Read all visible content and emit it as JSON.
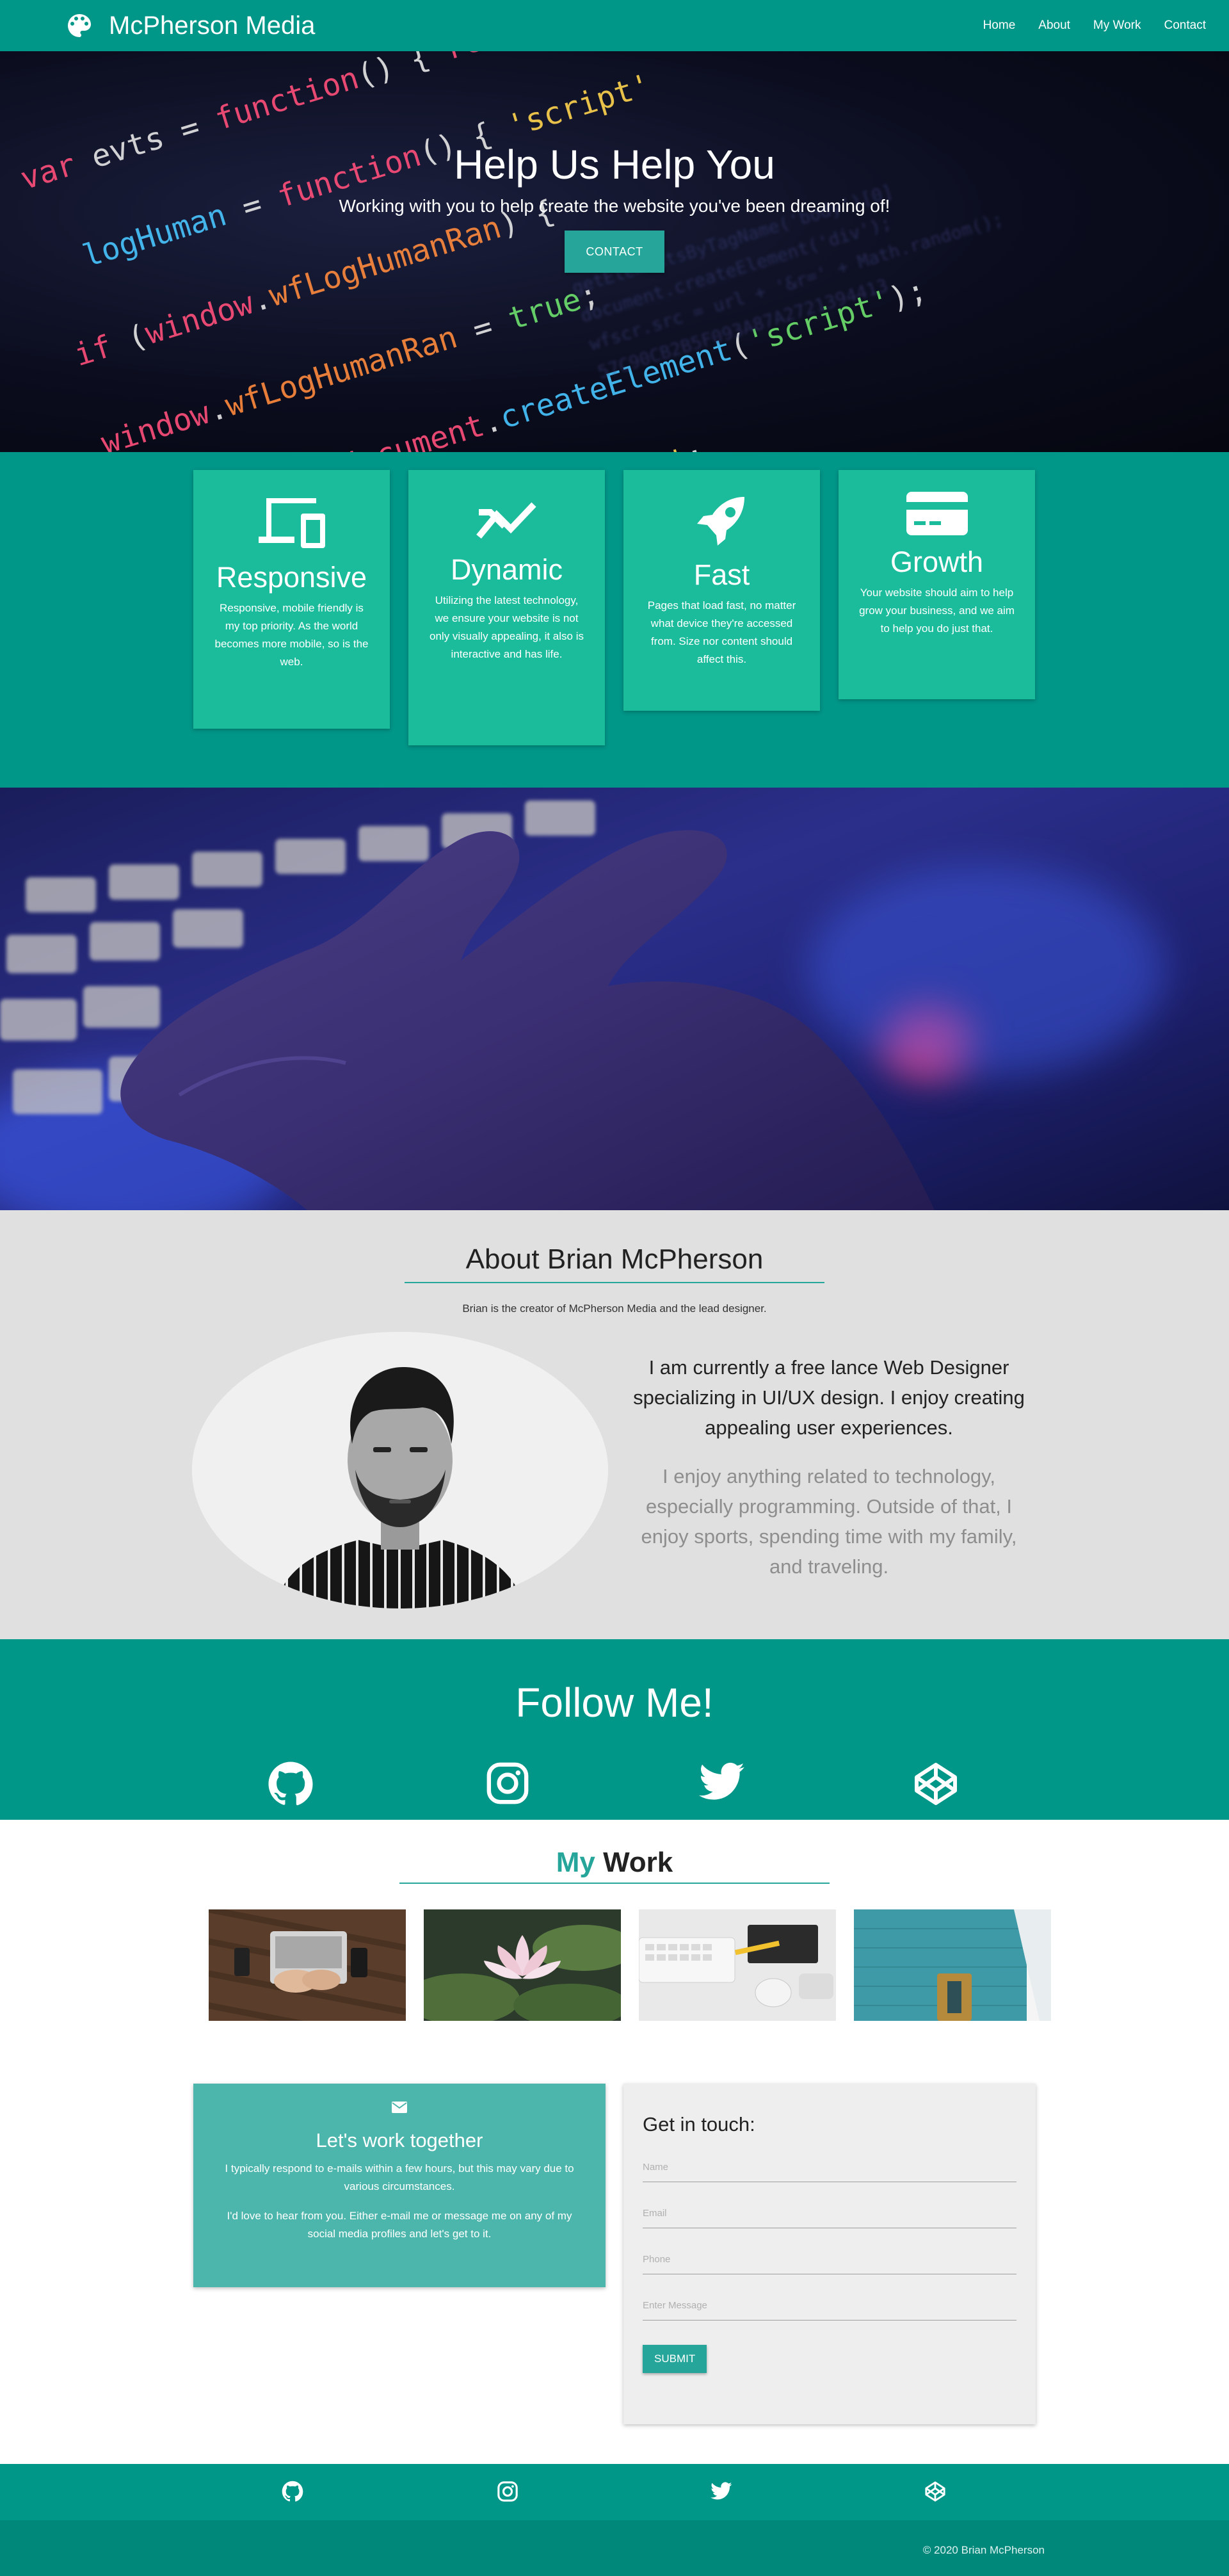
{
  "nav": {
    "brand": "McPherson Media",
    "links": [
      "Home",
      "About",
      "My Work",
      "Contact"
    ]
  },
  "hero": {
    "title": "Help Us Help You",
    "subtitle": "Working with you to help create the website you've been dreaming of!",
    "button": "CONTACT"
  },
  "features": [
    {
      "icon": "devices-icon",
      "title": "Responsive",
      "text": "Responsive, mobile friendly is my top priority. As the world becomes more mobile, so is the web."
    },
    {
      "icon": "trending-icon",
      "title": "Dynamic",
      "text": "Utilizing the latest technology, we ensure your website is not only visually appealing, it also is interactive and has life."
    },
    {
      "icon": "rocket-icon",
      "title": "Fast",
      "text": "Pages that load fast, no matter what device they're accessed from. Size nor content should affect this."
    },
    {
      "icon": "credit-card-icon",
      "title": "Growth",
      "text": "Your website should aim to help grow your business, and we aim to help you do just that."
    }
  ],
  "about": {
    "title": "About Brian McPherson",
    "intro": "Brian is the creator of McPherson Media and the lead designer.",
    "p1": "I am currently a free lance Web Designer specializing in UI/UX design. I enjoy creating appealing user experiences.",
    "p2": "I enjoy anything related to technology, especially programming. Outside of that, I enjoy sports, spending time with my family, and traveling."
  },
  "follow": {
    "title": "Follow Me!",
    "icons": [
      "github-icon",
      "instagram-icon",
      "twitter-icon",
      "codepen-icon"
    ]
  },
  "work": {
    "title_accent": "My",
    "title_rest": " Work"
  },
  "contact": {
    "card_title": "Let's work together",
    "card_text1": "I typically respond to e-mails within a few hours, but this may vary due to various circumstances.",
    "card_text2": "I'd love to hear from you. Either e-mail me or message me on any of my social media profiles and let's get to it.",
    "form_title": "Get in touch:",
    "fields": {
      "name": "Name",
      "email": "Email",
      "phone": "Phone",
      "message": "Enter Message"
    },
    "submit": "SUBMIT"
  },
  "footer": {
    "copyright": "© 2020 Brian McPherson"
  },
  "colors": {
    "primary": "#009688",
    "accent": "#26a69a",
    "card": "#1abc9c"
  }
}
